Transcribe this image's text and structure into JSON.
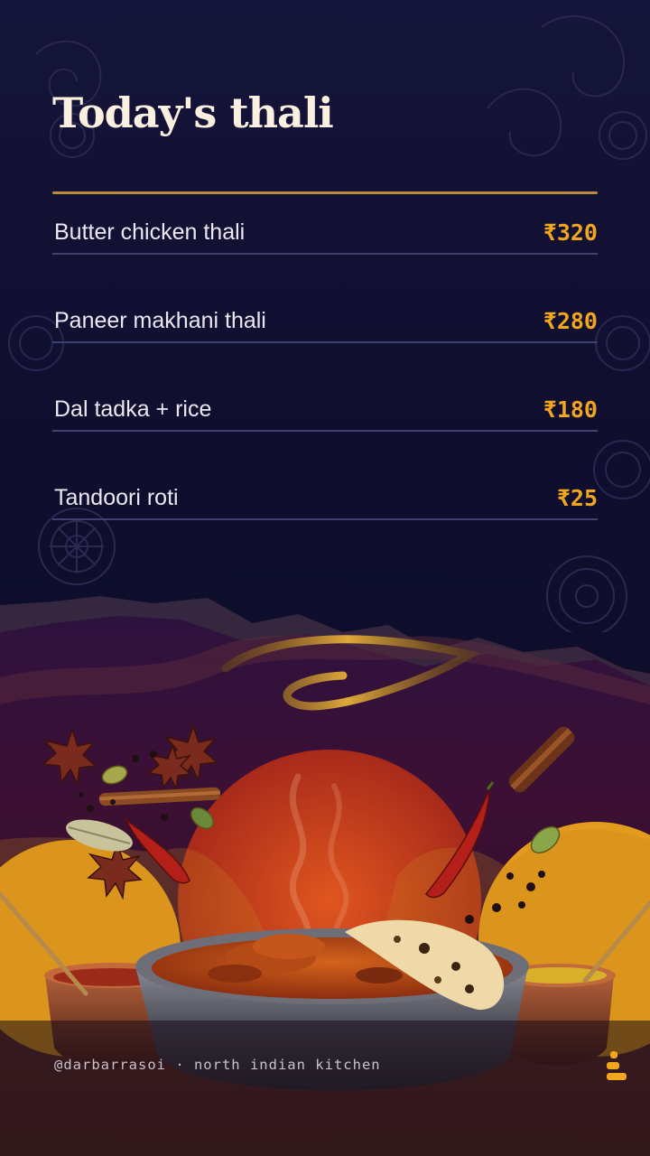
{
  "title": "Today's thali",
  "menu_items": [
    {
      "name": "Butter chicken thali",
      "price": "₹320"
    },
    {
      "name": "Paneer makhani thali",
      "price": "₹280"
    },
    {
      "name": "Dal tadka + rice",
      "price": "₹180"
    },
    {
      "name": "Tandoori roti",
      "price": "₹25"
    }
  ],
  "footer": {
    "handle": "@darbarrasoi",
    "separator": "·",
    "tagline": "north indian kitchen",
    "text": "@darbarrasoi · north indian kitchen"
  },
  "colors": {
    "background": "#0f0e2e",
    "title": "#fbf0e0",
    "price": "#f2a51f",
    "divider": "#3f4170",
    "accent_rule": "#b88a3c",
    "lower_scene": "#4a1230"
  },
  "icons": [
    "paisley-pattern",
    "mandala-pattern",
    "star-anise-icon",
    "cinnamon-icon",
    "chili-icon",
    "cardamom-icon",
    "brand-bars-icon"
  ]
}
